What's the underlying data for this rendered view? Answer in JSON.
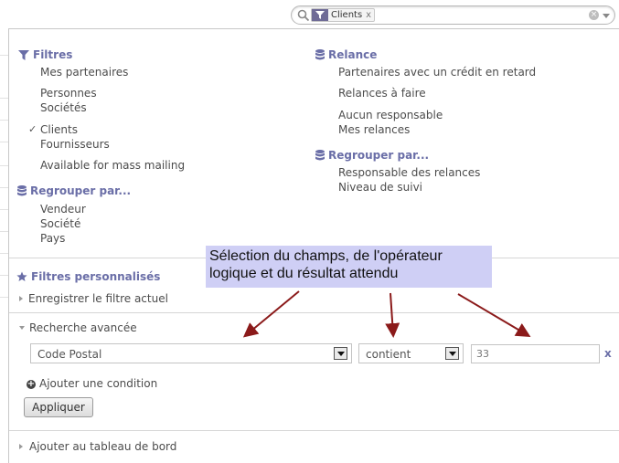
{
  "search": {
    "facet_value": "Clients",
    "facet_remove": "x"
  },
  "filters": {
    "header": "Filtres",
    "items": [
      "Mes partenaires",
      "Personnes",
      "Sociétés",
      "Clients",
      "Fournisseurs",
      "Available for mass mailing"
    ],
    "checked": "Clients"
  },
  "groupby_left": {
    "header": "Regrouper par...",
    "items": [
      "Vendeur",
      "Société",
      "Pays"
    ]
  },
  "relance": {
    "header": "Relance",
    "items": [
      "Partenaires avec un crédit en retard",
      "Relances à faire",
      "Aucun responsable",
      "Mes relances"
    ]
  },
  "groupby_right": {
    "header": "Regrouper par...",
    "items": [
      "Responsable des relances",
      "Niveau de suivi"
    ]
  },
  "custom_filters": {
    "header": "Filtres personnalisés",
    "save_current": "Enregistrer le filtre actuel"
  },
  "advanced": {
    "header": "Recherche avancée",
    "field_value": "Code Postal",
    "operator_value": "contient",
    "input_value": "33",
    "delete_label": "x",
    "add_condition": "Ajouter une condition",
    "apply_label": "Appliquer"
  },
  "dashboard": {
    "add_label": "Ajouter au tableau de bord"
  },
  "annotation": {
    "line1": "Sélection du champs, de l'opérateur",
    "line2": "logique et du résultat attendu",
    "color": "#cfcff5",
    "arrow_color": "#8b1a1a"
  }
}
